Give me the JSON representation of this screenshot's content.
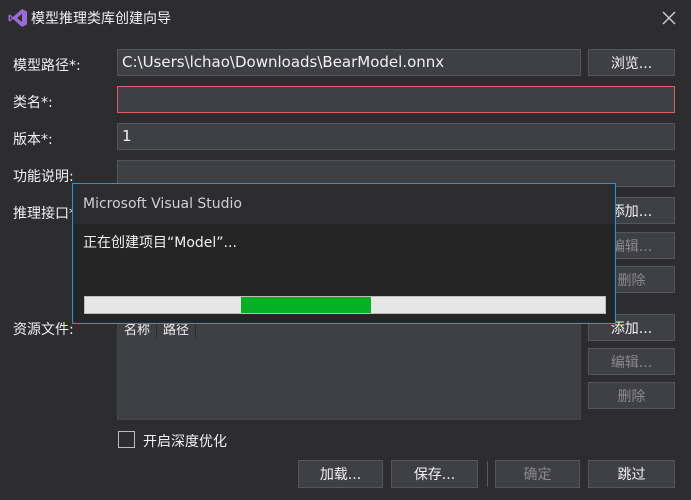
{
  "window": {
    "title": "模型推理类库创建向导"
  },
  "form": {
    "model_path": {
      "label": "模型路径*:",
      "value": "C:\\Users\\lchao\\Downloads\\BearModel.onnx",
      "browse_label": "浏览..."
    },
    "class_name": {
      "label": "类名*:",
      "value": ""
    },
    "version": {
      "label": "版本*:",
      "value": "1"
    },
    "description": {
      "label": "功能说明:",
      "value": ""
    },
    "inference_api": {
      "label": "推理接口*:",
      "add_label": "添加...",
      "edit_label": "编辑...",
      "delete_label": "删除"
    },
    "resource_files": {
      "label": "资源文件:",
      "columns": [
        "名称",
        "路径"
      ],
      "add_label": "添加...",
      "edit_label": "编辑...",
      "delete_label": "删除"
    },
    "deep_optimization": {
      "label": "开启深度优化",
      "checked": false
    }
  },
  "footer": {
    "load_label": "加载...",
    "save_label": "保存...",
    "ok_label": "确定",
    "skip_label": "跳过"
  },
  "progress_dialog": {
    "title": "Microsoft Visual Studio",
    "message": "正在创建项目“Model”...",
    "progress_start": 0.3,
    "progress_end": 0.55,
    "fill_color": "#06b025"
  },
  "colors": {
    "accent": "#1c97ea",
    "error": "#e06060"
  }
}
